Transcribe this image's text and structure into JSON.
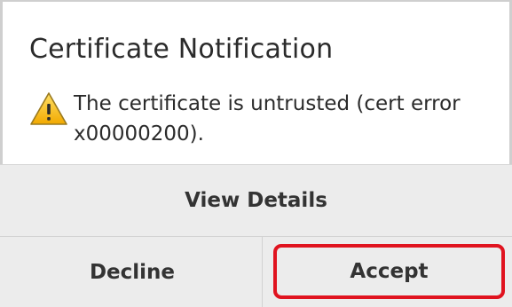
{
  "dialog": {
    "title": "Certificate Notification",
    "message_line1": "The certificate is untrusted (cert error",
    "message_line2": "x00000200).",
    "warning_icon": "warning-triangle-icon",
    "accent_color": "#e0131f",
    "warning_color": "#f4b400"
  },
  "buttons": {
    "view_details": "View Details",
    "decline": "Decline",
    "accept": "Accept"
  }
}
